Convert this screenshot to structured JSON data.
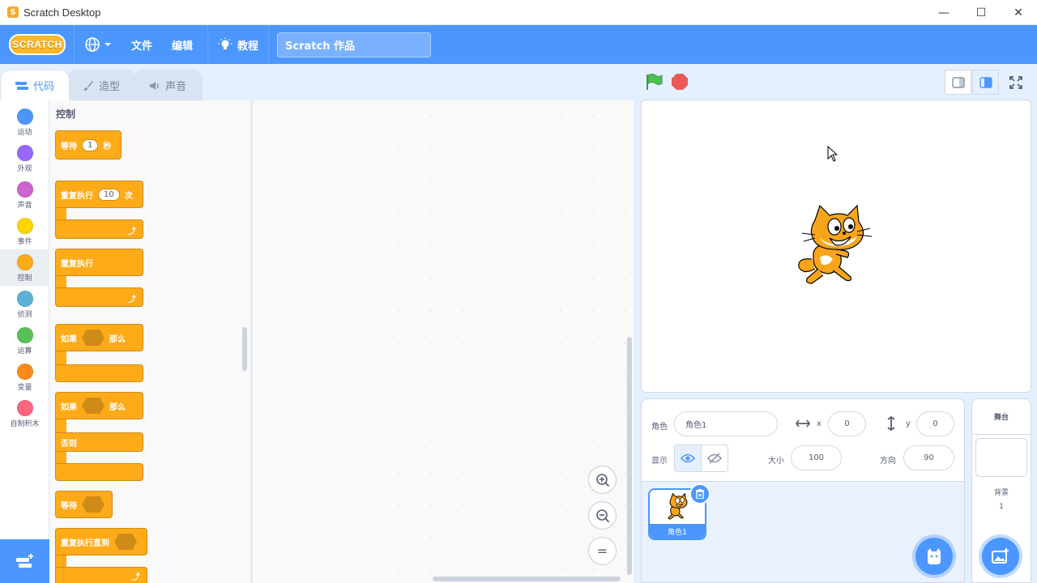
{
  "window": {
    "title": "Scratch Desktop",
    "minimize": "—",
    "maximize": "☐",
    "close": "✕"
  },
  "menubar": {
    "logo": "SCRATCH",
    "file": "文件",
    "edit": "编辑",
    "tutorials": "教程",
    "project_title": "Scratch 作品"
  },
  "tabs": {
    "code": "代码",
    "costumes": "造型",
    "sounds": "声音"
  },
  "categories": [
    {
      "label": "运动",
      "color": "#4c97ff"
    },
    {
      "label": "外观",
      "color": "#9966ff"
    },
    {
      "label": "声音",
      "color": "#cf63cf"
    },
    {
      "label": "事件",
      "color": "#ffd500"
    },
    {
      "label": "控制",
      "color": "#ffab19"
    },
    {
      "label": "侦测",
      "color": "#5cb1d6"
    },
    {
      "label": "运算",
      "color": "#59c059"
    },
    {
      "label": "变量",
      "color": "#ff8c1a"
    },
    {
      "label": "自制积木",
      "color": "#ff6680"
    }
  ],
  "palette": {
    "title": "控制",
    "wait": {
      "label": "等待",
      "value": "1",
      "unit": "秒"
    },
    "repeat": {
      "label": "重复执行",
      "value": "10",
      "unit": "次"
    },
    "forever": {
      "label": "重复执行"
    },
    "if_then": {
      "label": "如果",
      "then": "那么"
    },
    "if_else": {
      "label": "如果",
      "then": "那么",
      "else": "否则"
    },
    "wait_until": {
      "label": "等待"
    },
    "repeat_until": {
      "label": "重复执行直到"
    }
  },
  "zoom": {
    "in": "+",
    "out": "−",
    "reset": "="
  },
  "sprite_info": {
    "sprite_label": "角色",
    "sprite_name": "角色1",
    "x_label": "x",
    "x_value": "0",
    "y_label": "y",
    "y_value": "0",
    "show_label": "显示",
    "size_label": "大小",
    "size_value": "100",
    "direction_label": "方向",
    "direction_value": "90"
  },
  "sprites": [
    {
      "name": "角色1"
    }
  ],
  "stage_panel": {
    "title": "舞台",
    "backdrops_label": "背景",
    "backdrops_count": "1"
  },
  "colors": {
    "accent": "#4c97ff",
    "control": "#ffab19",
    "flag": "#4cbf56",
    "stop": "#ec5959"
  }
}
